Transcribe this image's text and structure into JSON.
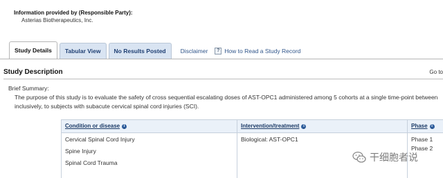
{
  "provider": {
    "header": "Information provided by (Responsible Party):",
    "name": "Asterias Biotherapeutics, Inc."
  },
  "tabs": [
    {
      "label": "Study Details",
      "active": true
    },
    {
      "label": "Tabular View",
      "active": false
    },
    {
      "label": "No Results Posted",
      "active": false
    }
  ],
  "links": {
    "disclaimer": "Disclaimer",
    "how_to_read": "How to Read a Study Record"
  },
  "section": {
    "title": "Study Description",
    "goto": "Go to"
  },
  "brief": {
    "label": "Brief Summary:",
    "lines": [
      "The purpose of this study is to evaluate the safety of cross sequential escalating doses of AST-OPC1 administered among 5 cohorts at a single time-point between",
      "inclusively, to subjects with subacute cervical spinal cord injuries (SCI)."
    ]
  },
  "conditions_table": {
    "headers": [
      "Condition or disease",
      "Intervention/treatment",
      "Phase"
    ],
    "conditions": [
      "Cervical Spinal Cord Injury",
      "Spine Injury",
      "Spinal Cord Trauma"
    ],
    "interventions": [
      "Biological: AST-OPC1"
    ],
    "phases": [
      "Phase 1",
      "Phase 2"
    ]
  },
  "watermark": {
    "text": "干细胞者说",
    "icon": "wechat-logo"
  },
  "colors": {
    "tab_inactive_bg": "#d9e4f2",
    "table_header_bg": "#eaf1f9",
    "link": "#30558a",
    "info_icon": "#2f5f9e"
  }
}
